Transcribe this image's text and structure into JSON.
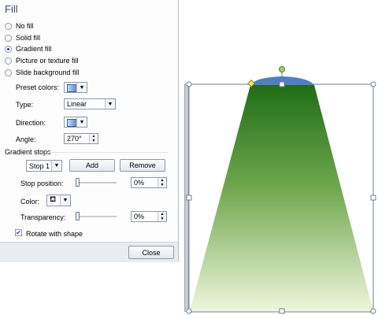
{
  "panel": {
    "title": "Fill",
    "fill_options": [
      {
        "label": "No fill",
        "selected": false
      },
      {
        "label": "Solid fill",
        "selected": false
      },
      {
        "label": "Gradient fill",
        "selected": true
      },
      {
        "label": "Picture or texture fill",
        "selected": false
      },
      {
        "label": "Slide background fill",
        "selected": false
      }
    ],
    "preset_colors_label": "Preset colors:",
    "type_label": "Type:",
    "type_value": "Linear",
    "direction_label": "Direction:",
    "angle_label": "Angle:",
    "angle_value": "270°",
    "gradient_stops_label": "Gradient stops",
    "stop_value": "Stop 1",
    "add_label": "Add",
    "remove_label": "Remove",
    "stop_position_label": "Stop position:",
    "stop_position_value": "0%",
    "color_label": "Color:",
    "transparency_label": "Transparency:",
    "transparency_value": "0%",
    "rotate_label": "Rotate with shape",
    "rotate_checked": true,
    "close_label": "Close"
  },
  "colors": {
    "gradient_top": "#1f6e17",
    "gradient_bottom": "#eef6dc",
    "top_cap": "#4f7fbd",
    "rotation_handle": "#9bd36b",
    "adjust_handle": "#f3e95a"
  }
}
